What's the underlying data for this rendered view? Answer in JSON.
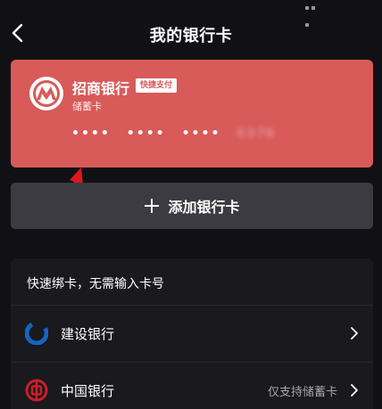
{
  "header": {
    "title": "我的银行卡"
  },
  "card": {
    "bank_name": "招商银行",
    "badge": "快捷支付",
    "card_type": "储蓄卡",
    "mask_groups": [
      "••••",
      "••••",
      "••••"
    ],
    "last_digits_obscured": "0376",
    "card_color": "#d85a59"
  },
  "add_card": {
    "label": "添加银行卡"
  },
  "quick_bind": {
    "title": "快速绑卡，无需输入卡号",
    "banks": [
      {
        "name": "建设银行",
        "note": "",
        "icon": "ccb-logo-icon"
      },
      {
        "name": "中国银行",
        "note": "仅支持储蓄卡",
        "icon": "boc-logo-icon"
      }
    ]
  },
  "colors": {
    "background": "#111115",
    "button": "#3b3b41",
    "arrow_annotation": "#e0161b",
    "ccb_blue": "#1565c0",
    "boc_red": "#c8202a"
  }
}
